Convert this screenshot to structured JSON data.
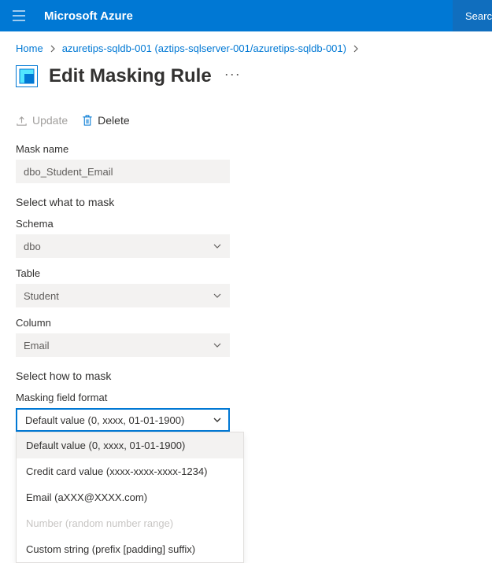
{
  "header": {
    "brand": "Microsoft Azure",
    "search_label": "Search"
  },
  "breadcrumb": {
    "home": "Home",
    "item": "azuretips-sqldb-001 (aztips-sqlserver-001/azuretips-sqldb-001)"
  },
  "page": {
    "title": "Edit Masking Rule"
  },
  "commands": {
    "update": "Update",
    "delete": "Delete"
  },
  "labels": {
    "mask_name": "Mask name",
    "select_what": "Select what to mask",
    "schema": "Schema",
    "table": "Table",
    "column": "Column",
    "select_how": "Select how to mask",
    "masking_format": "Masking field format"
  },
  "values": {
    "mask_name": "dbo_Student_Email",
    "schema": "dbo",
    "table": "Student",
    "column": "Email",
    "masking_format": "Default value (0, xxxx, 01-01-1900)"
  },
  "options": {
    "default": "Default value (0, xxxx, 01-01-1900)",
    "creditcard": "Credit card value (xxxx-xxxx-xxxx-1234)",
    "email": "Email (aXXX@XXXX.com)",
    "number": "Number (random number range)",
    "custom": "Custom string (prefix [padding] suffix)"
  }
}
